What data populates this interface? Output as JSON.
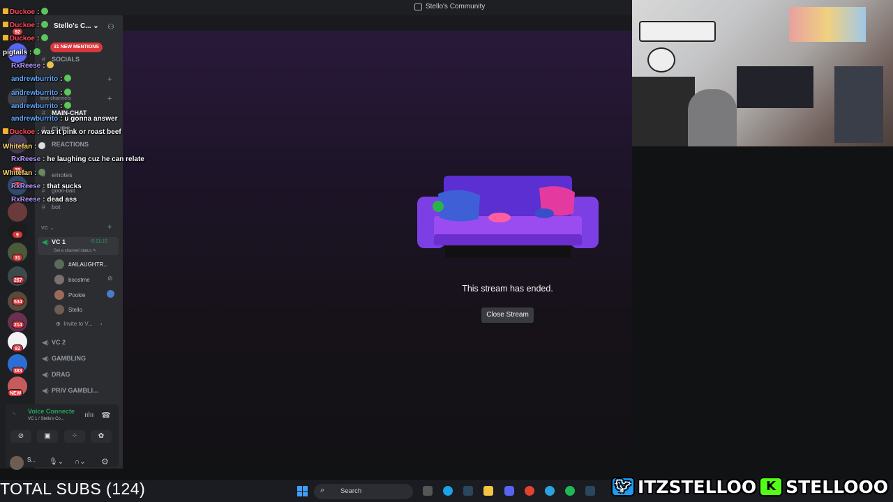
{
  "window": {
    "title": "Stello's Community"
  },
  "server": {
    "name": "Stello's C...",
    "new_mentions": "31 NEW MENTIONS"
  },
  "rail_badges": [
    "92",
    "35",
    "1",
    "9",
    "31",
    "267",
    "534",
    "214",
    "92",
    "383",
    "NEW"
  ],
  "categories": {
    "socials": "SOCIALS",
    "text": "text channels",
    "vc": "VC"
  },
  "channels": {
    "main_chat": "MAIN-CHAT",
    "clips": "CLIPS",
    "reactions": "REACTIONS",
    "emotes": "emotes",
    "goon_bait": "goon-bait",
    "bot": "bot",
    "vc1": "VC 1",
    "vc1_timer": "6:11:15",
    "vc1_status": "Set a channel status",
    "vc2": "VC 2",
    "gambling": "GAMBLING",
    "drag": "DRAG",
    "priv_gambling": "PRIV GAMBLI..."
  },
  "vc_users": [
    "#AILAUGHTR...",
    "boostme",
    "Pookie",
    "Stello"
  ],
  "invite": "Invite to V...",
  "voice": {
    "connected": "Voice Connecte",
    "sub": "VC 1 / Stello's Co..."
  },
  "user": {
    "name": "S..."
  },
  "stream": {
    "ended": "This stream has ended.",
    "close": "Close Stream"
  },
  "chat": [
    {
      "name": "Duckoe",
      "msg": "",
      "color": "#ff4b5c",
      "mod": true
    },
    {
      "name": "Duckoe",
      "msg": "",
      "color": "#ff4b5c",
      "mod": true
    },
    {
      "name": "Duckoe",
      "msg": "",
      "color": "#ff4b5c",
      "mod": true
    },
    {
      "name": "pigtails",
      "msg": "",
      "color": "#ffffff",
      "mod": false
    },
    {
      "name": "RxReese",
      "msg": "",
      "color": "#b79cff",
      "mod": false
    },
    {
      "name": "andrewburrito",
      "msg": "",
      "color": "#5fa8ff",
      "mod": false
    },
    {
      "name": "andrewburrito",
      "msg": "",
      "color": "#5fa8ff",
      "mod": false
    },
    {
      "name": "andrewburrito",
      "msg": "",
      "color": "#5fa8ff",
      "mod": false
    },
    {
      "name": "andrewburrito",
      "msg": "u gonna answer",
      "color": "#5fa8ff",
      "mod": false
    },
    {
      "name": "Duckoe",
      "msg": "was it pink or roast beef",
      "color": "#ff4b5c",
      "mod": true
    },
    {
      "name": "Whitefan",
      "msg": "",
      "color": "#ffd86b",
      "mod": false
    },
    {
      "name": "RxReese",
      "msg": "he laughing cuz he can relate",
      "color": "#b79cff",
      "mod": false
    },
    {
      "name": "Whitefan",
      "msg": "",
      "color": "#ffd86b",
      "mod": false
    },
    {
      "name": "RxReese",
      "msg": "that sucks",
      "color": "#b79cff",
      "mod": false
    },
    {
      "name": "RxReese",
      "msg": "dead ass",
      "color": "#b79cff",
      "mod": false
    }
  ],
  "footer": {
    "total_subs": "TOTAL SUBS (124)",
    "search": "Search"
  },
  "social": {
    "twitter": "ITZSTELLOO",
    "kick": "STELLOOO"
  },
  "colors": {
    "accent": "#5865f2",
    "danger": "#da373c",
    "online": "#23a55a",
    "kick": "#53fc18",
    "twitter": "#1d9bf0"
  }
}
